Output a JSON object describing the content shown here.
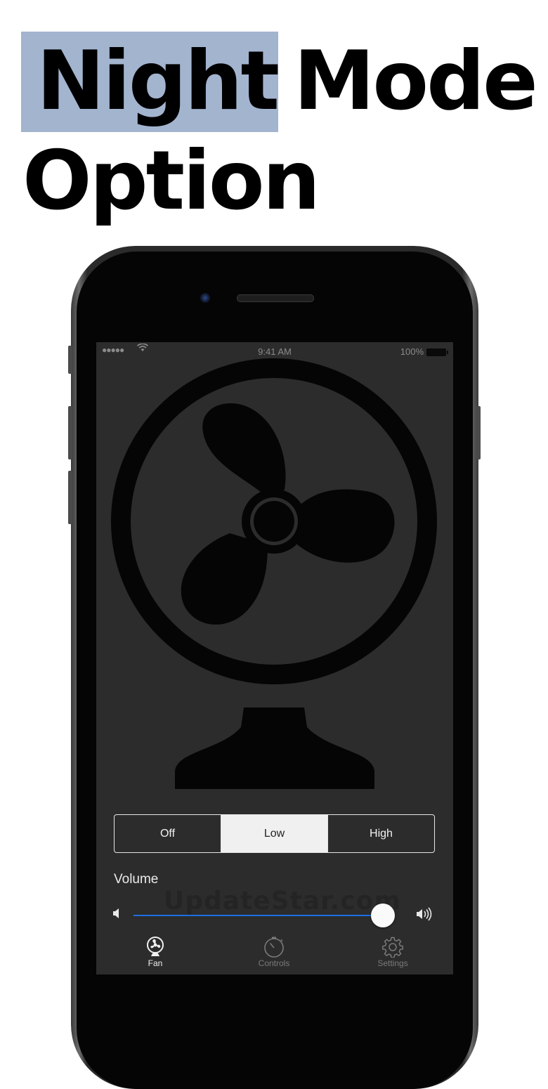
{
  "headline": {
    "line1_highlighted": "Night",
    "line1_rest": "Mode",
    "line2": "Option",
    "highlight_color": "#a3b4cf"
  },
  "status_bar": {
    "signal": "●●●●●",
    "time": "9:41 AM",
    "battery": "100%"
  },
  "speed_control": {
    "options": [
      "Off",
      "Low",
      "High"
    ],
    "selected": "Low"
  },
  "volume": {
    "label": "Volume",
    "level": 0.97,
    "track_color": "#1b6fe0",
    "min_icon": "speaker-low-icon",
    "max_icon": "speaker-high-icon"
  },
  "watermark": "UpdateStar.com",
  "tab_bar": {
    "tabs": [
      {
        "label": "Fan",
        "icon": "fan-icon",
        "active": true
      },
      {
        "label": "Controls",
        "icon": "stopwatch-icon",
        "active": false
      },
      {
        "label": "Settings",
        "icon": "gear-icon",
        "active": false
      }
    ]
  },
  "colors": {
    "screen_background": "#2c2c2c",
    "fan_artwork": "#050505"
  }
}
